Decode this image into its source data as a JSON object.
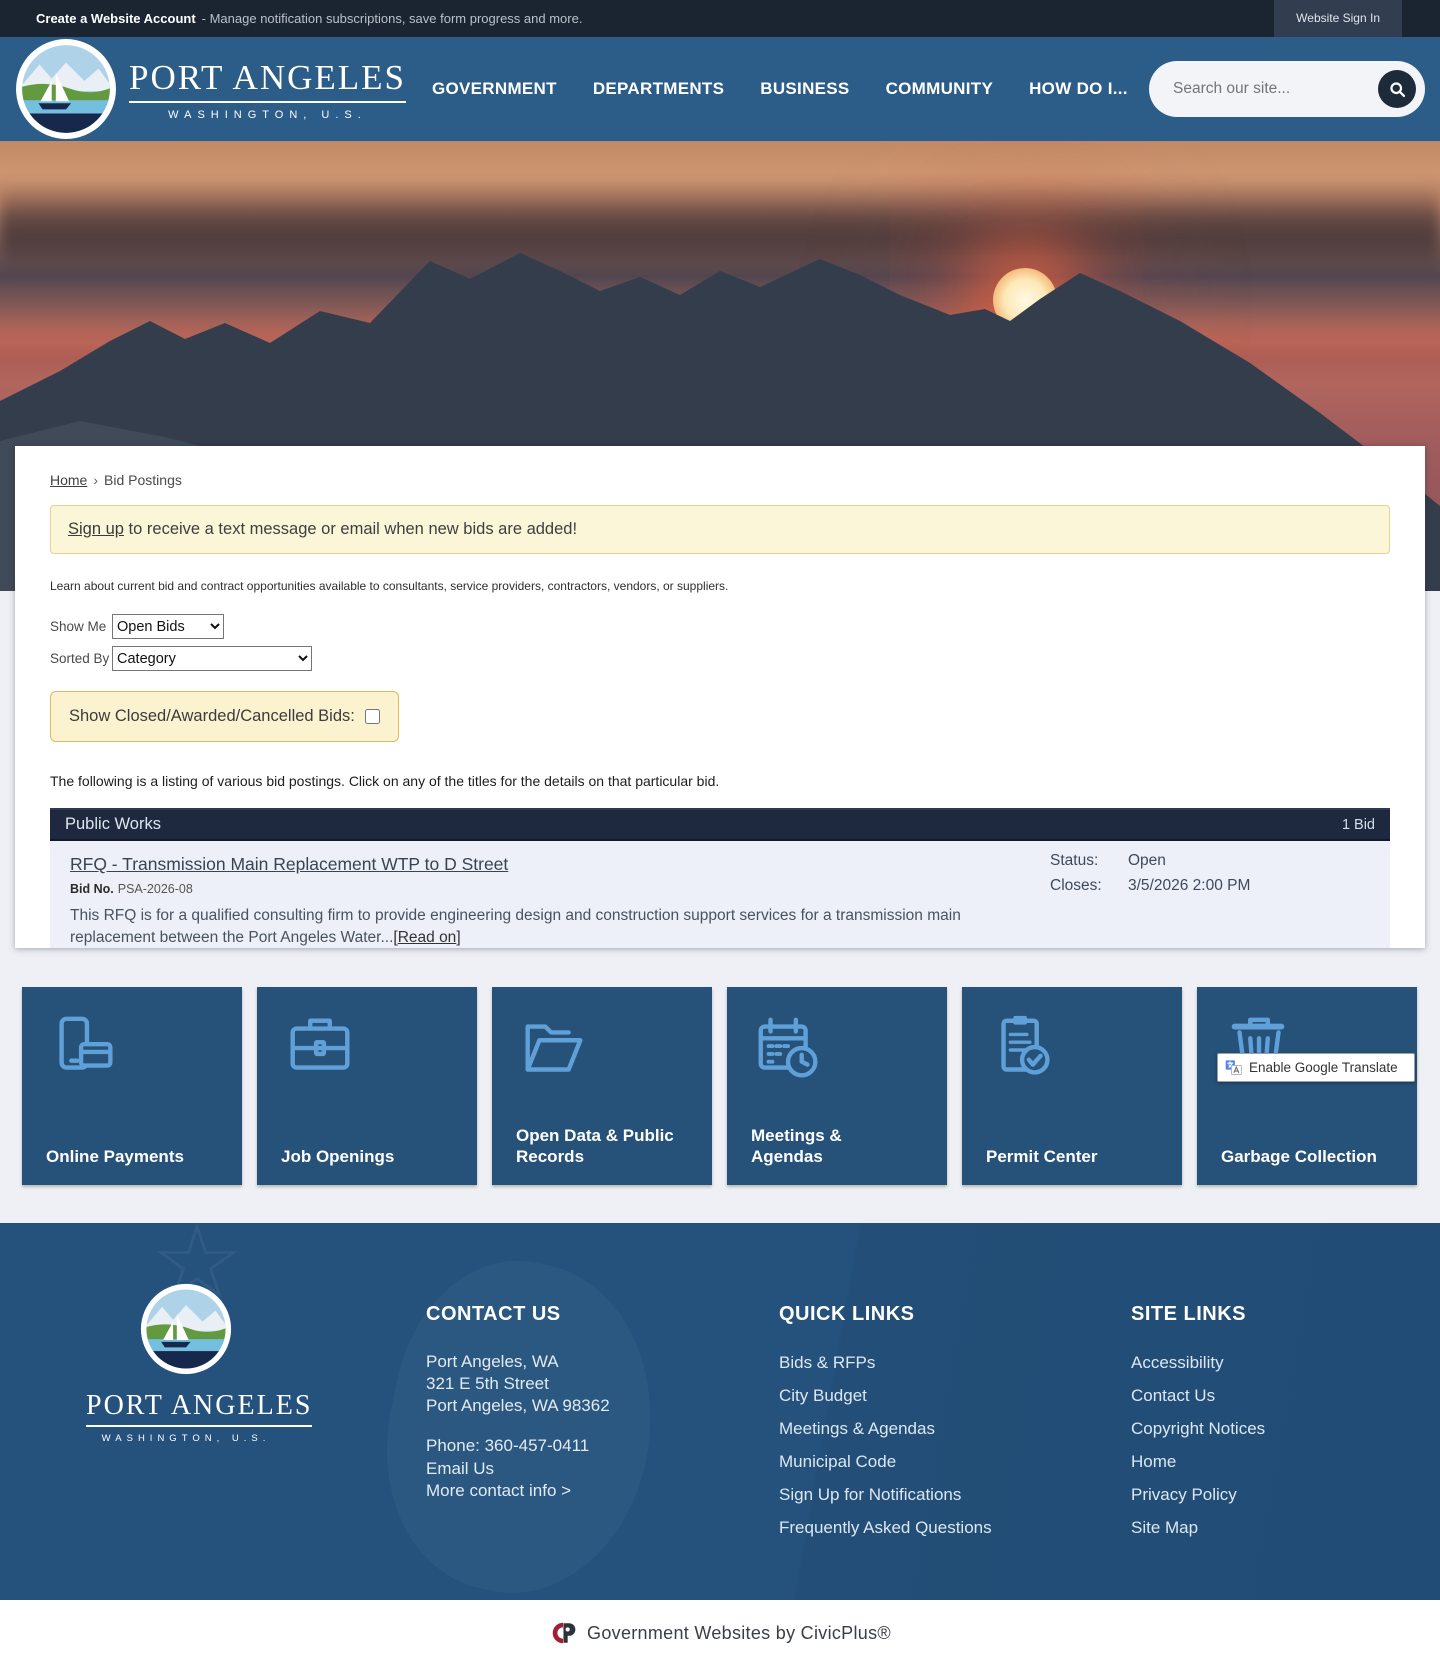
{
  "colors": {
    "topbar": "#1b2531",
    "navbar": "#2c5c88",
    "tile_background": "#265179",
    "tile_icon_blue": "#60a0d8",
    "footer": "#24527c",
    "category_bar": "#1e2940",
    "banner_background": "#fcf6d9",
    "civicplus_red": "#a51e32"
  },
  "topbar": {
    "account_link": "Create a Website Account",
    "account_desc": "- Manage notification subscriptions, save form progress and more.",
    "signin_label": "Website Sign In"
  },
  "brand": {
    "wordmark": "PORT ANGELES",
    "tagline": "WASHINGTON, U.S."
  },
  "header": {
    "nav": [
      "GOVERNMENT",
      "DEPARTMENTS",
      "BUSINESS",
      "COMMUNITY",
      "HOW DO I..."
    ],
    "search_placeholder": "Search our site..."
  },
  "breadcrumb": {
    "home": "Home",
    "separator": "›",
    "current": "Bid Postings"
  },
  "signup_banner": {
    "link": "Sign up",
    "text": " to receive a text message or email when new bids are added!"
  },
  "intro": "Learn about current bid and contract opportunities available to consultants, service providers, contractors, vendors, or suppliers.",
  "filters": {
    "show_me_label": "Show Me",
    "show_me_value": "Open Bids",
    "sorted_by_label": "Sorted By",
    "sorted_by_value": "Category",
    "show_closed_label": "Show Closed/Awarded/Cancelled Bids:"
  },
  "listing_note": "The following is a listing of various bid postings. Click on any of the titles for the details on that particular bid.",
  "bid_category": {
    "name": "Public Works",
    "count": "1 Bid"
  },
  "bid": {
    "title": "RFQ - Transmission Main Replacement WTP to D Street",
    "bid_no_label": "Bid No.",
    "bid_no": "PSA-2026-08",
    "status_label": "Status:",
    "status": "Open",
    "closes_label": "Closes:",
    "closes": "3/5/2026 2:00 PM",
    "description": "This RFQ is for a qualified consulting firm to provide engineering design and construction support services for a transmission main replacement between the Port Angeles Water...",
    "read_on_prefix": "[",
    "read_on": "Read on",
    "read_on_suffix": "]"
  },
  "tiles": [
    {
      "label": "Online Payments",
      "icon": "payment-icon"
    },
    {
      "label": "Job Openings",
      "icon": "briefcase-icon"
    },
    {
      "label": "Open Data & Public Records",
      "icon": "open-folder-icon"
    },
    {
      "label": "Meetings & Agendas",
      "icon": "calendar-clock-icon"
    },
    {
      "label": "Permit Center",
      "icon": "clipboard-check-icon"
    },
    {
      "label": "Garbage Collection",
      "icon": "trash-icon"
    }
  ],
  "translate": {
    "label": "Enable Google Translate"
  },
  "footer": {
    "contact": {
      "heading": "CONTACT US",
      "lines": [
        "Port Angeles, WA",
        "321 E 5th Street",
        "Port Angeles, WA 98362"
      ],
      "phone": "Phone: 360-457-0411",
      "email": "Email Us",
      "more": "More contact info >"
    },
    "quick_links": {
      "heading": "QUICK LINKS",
      "items": [
        "Bids & RFPs",
        "City Budget",
        "Meetings & Agendas",
        "Municipal Code",
        "Sign Up for Notifications",
        "Frequently Asked Questions"
      ]
    },
    "site_links": {
      "heading": "SITE LINKS",
      "items": [
        "Accessibility",
        "Contact Us",
        "Copyright Notices",
        "Home",
        "Privacy Policy",
        "Site Map"
      ]
    }
  },
  "civicplus": {
    "text": "Government Websites by CivicPlus®"
  }
}
